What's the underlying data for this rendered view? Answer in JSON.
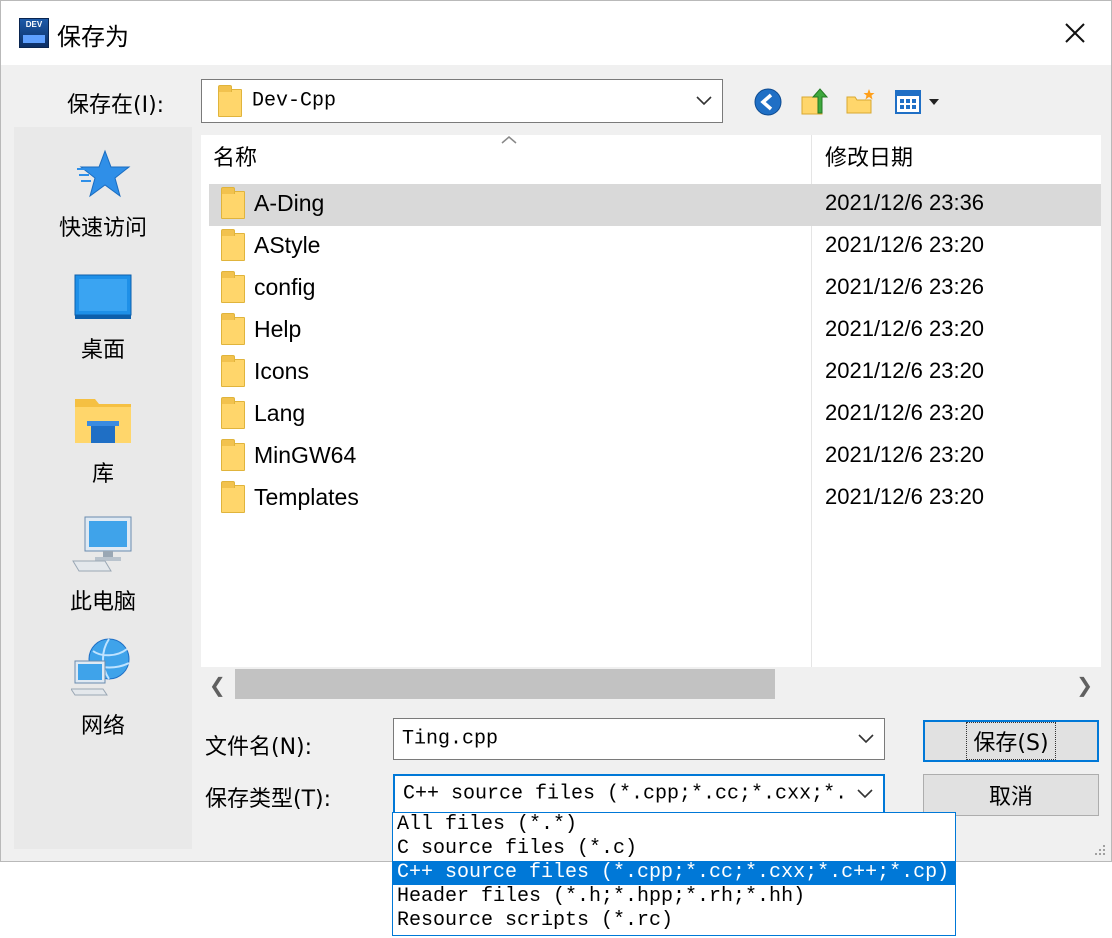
{
  "window": {
    "title": "保存为"
  },
  "save_in": {
    "label": "保存在(I):",
    "value": "Dev-Cpp"
  },
  "toolbar": {
    "icons": [
      "back-icon",
      "up-folder-icon",
      "new-folder-icon",
      "view-menu-icon"
    ]
  },
  "places": [
    {
      "label": "快速访问",
      "icon": "quick-access-star-icon"
    },
    {
      "label": "桌面",
      "icon": "desktop-icon"
    },
    {
      "label": "库",
      "icon": "library-icon"
    },
    {
      "label": "此电脑",
      "icon": "this-pc-icon"
    },
    {
      "label": "网络",
      "icon": "network-icon"
    }
  ],
  "file_list": {
    "columns": {
      "name": "名称",
      "date": "修改日期"
    },
    "rows": [
      {
        "name": "A-Ding",
        "date": "2021/12/6 23:36"
      },
      {
        "name": "AStyle",
        "date": "2021/12/6 23:20"
      },
      {
        "name": "config",
        "date": "2021/12/6 23:26"
      },
      {
        "name": "Help",
        "date": "2021/12/6 23:20"
      },
      {
        "name": "Icons",
        "date": "2021/12/6 23:20"
      },
      {
        "name": "Lang",
        "date": "2021/12/6 23:20"
      },
      {
        "name": "MinGW64",
        "date": "2021/12/6 23:20"
      },
      {
        "name": "Templates",
        "date": "2021/12/6 23:20"
      }
    ],
    "selected_row": "A-Ding"
  },
  "filename": {
    "label": "文件名(N):",
    "value": "Ting.cpp"
  },
  "filetype": {
    "label": "保存类型(T):",
    "value": "C++ source files (*.cpp;*.cc;*.cxx;*.",
    "options": [
      "All files (*.*)",
      "C source files (*.c)",
      "C++ source files (*.cpp;*.cc;*.cxx;*.c++;*.cp)",
      "Header files (*.h;*.hpp;*.rh;*.hh)",
      "Resource scripts (*.rc)"
    ],
    "selected_option": "C++ source files (*.cpp;*.cc;*.cxx;*.c++;*.cp)"
  },
  "buttons": {
    "save": "保存(S)",
    "cancel": "取消"
  },
  "colors": {
    "accent": "#0078d7",
    "folder": "#ffd66b",
    "selected_row": "#d9d9d9"
  }
}
